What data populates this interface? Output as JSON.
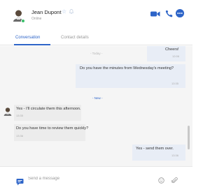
{
  "contact": {
    "name": "Jean Dupont",
    "status": "Online",
    "avatar_icon": "person-avatar-icon"
  },
  "header_actions": [
    {
      "name": "video-call",
      "icon": "video-camera-icon"
    },
    {
      "name": "phone-call",
      "icon": "phone-icon"
    },
    {
      "name": "more-options",
      "icon": "ellipsis-icon"
    }
  ],
  "tabs": [
    {
      "label": "Conversation",
      "active": true
    },
    {
      "label": "Contact details",
      "active": false
    }
  ],
  "dividers": {
    "today": "- Today -",
    "new": "- New -"
  },
  "messages": [
    {
      "direction": "out",
      "text": "Cheers!",
      "time": "12:06"
    },
    {
      "direction": "out",
      "text": "Do you have the minutes from Wednesday's meeting?",
      "time": "13:35"
    },
    {
      "direction": "in",
      "text": "Yes - I'll circulate them this afternoon.",
      "time": "13:35"
    },
    {
      "direction": "in",
      "text": "Do you have time to review them quickly?",
      "time": "13:36"
    },
    {
      "direction": "out",
      "text": "Yes - send them over.",
      "time": "13:36"
    }
  ],
  "composer": {
    "placeholder": "Send a message"
  },
  "colors": {
    "accent": "#2d64c8",
    "online": "#3bbf6b",
    "outgoing_bubble": "#e8edf6",
    "incoming_bubble": "#ececec",
    "conversation_bg": "#f5f5f5"
  }
}
